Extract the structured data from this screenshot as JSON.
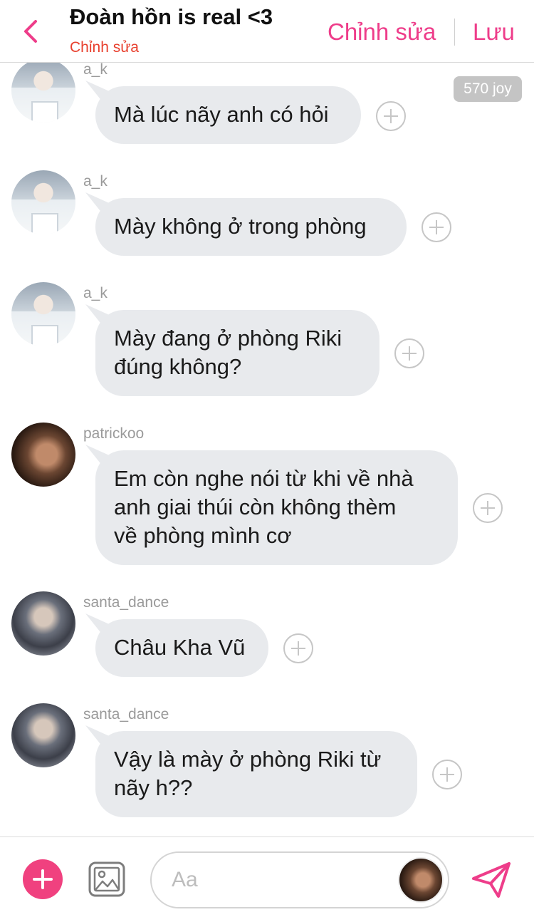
{
  "header": {
    "title": "Đoàn hồn is real <3",
    "subtitle": "Chỉnh sửa",
    "edit_label": "Chỉnh sửa",
    "save_label": "Lưu"
  },
  "joy_badge": "570 joy",
  "messages": [
    {
      "user": "a_k",
      "text": "Mà lúc nãy anh có hỏi"
    },
    {
      "user": "a_k",
      "text": "Mày không ở trong phòng"
    },
    {
      "user": "a_k",
      "text": "Mày đang ở phòng Riki\nđúng không?"
    },
    {
      "user": "patrickoo",
      "text": "Em còn nghe nói từ khi về nhà\nanh giai thúi còn không thèm\nvề phòng mình cơ"
    },
    {
      "user": "santa_dance",
      "text": "Châu Kha Vũ"
    },
    {
      "user": "santa_dance",
      "text": "Vậy là mày ở phòng Riki từ\nnãy h??"
    }
  ],
  "composer": {
    "placeholder": "Aa"
  },
  "colors": {
    "accent": "#ee3d8a",
    "subtitle": "#e8402e",
    "bubble": "#e8eaed"
  }
}
